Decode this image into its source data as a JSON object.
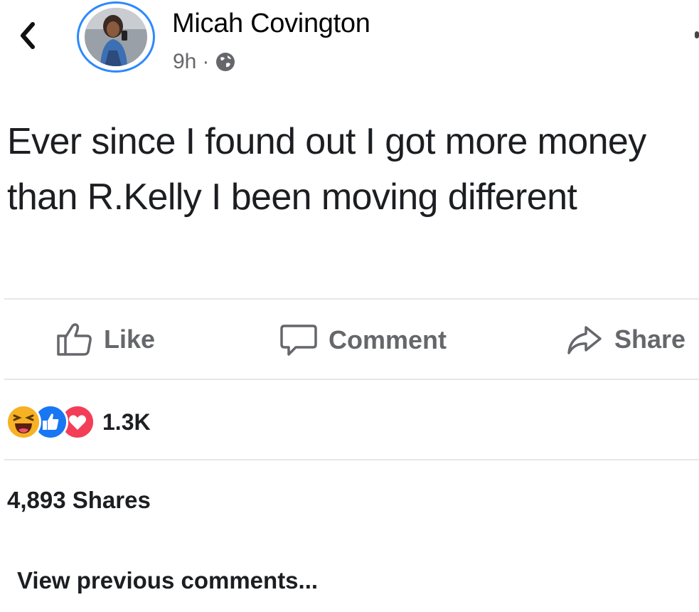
{
  "post": {
    "author": "Micah Covington",
    "time": "9h",
    "separator": "·",
    "text": "Ever since I found out I got more money than R.Kelly I been moving different"
  },
  "actions": {
    "like": "Like",
    "comment": "Comment",
    "share": "Share"
  },
  "reactions": {
    "count": "1.3K",
    "types": [
      "haha",
      "like",
      "love"
    ]
  },
  "stats": {
    "shares": "4,893 Shares"
  },
  "comments": {
    "view_previous": "View previous comments..."
  },
  "colors": {
    "accent": "#2d88ff",
    "secondary_text": "#65676b",
    "like_blue": "#1877f2",
    "love_red": "#f33e58",
    "haha_yellow": "#f7b125"
  }
}
